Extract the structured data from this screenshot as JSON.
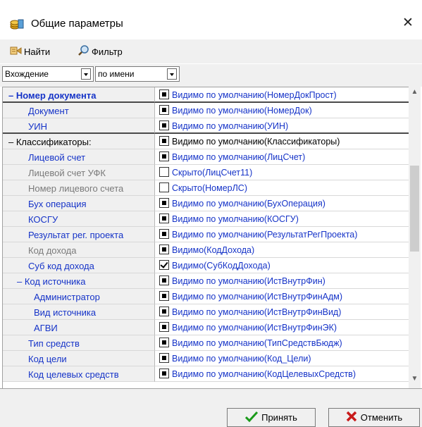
{
  "window": {
    "title": "Общие параметры",
    "close_label": "✕"
  },
  "toolbar": {
    "find_label": "Найти",
    "filter_label": "Фильтр"
  },
  "filterbar": {
    "mode_value": "Вхождение",
    "field_value": "по имени"
  },
  "rows": [
    {
      "label": "– Номер документа",
      "value": "Видимо по умолчанию(НомерДокПрост)",
      "check": "dot"
    },
    {
      "label": "Документ",
      "value": "Видимо по умолчанию(НомерДок)",
      "check": "dot"
    },
    {
      "label": "УИН",
      "value": "Видимо по умолчанию(УИН)",
      "check": "dot"
    },
    {
      "label": "– Классификаторы:",
      "value": "Видимо по умолчанию(Классификаторы)",
      "check": "dot"
    },
    {
      "label": "Лицевой счет",
      "value": "Видимо по умолчанию(ЛицСчет)",
      "check": "dot"
    },
    {
      "label": "Лицевой счет УФК",
      "value": "Скрыто(ЛицСчет11)",
      "check": "none"
    },
    {
      "label": "Номер лицевого счета",
      "value": "Скрыто(НомерЛС)",
      "check": "none"
    },
    {
      "label": "Бух операция",
      "value": "Видимо по умолчанию(БухОперация)",
      "check": "dot"
    },
    {
      "label": "КОСГУ",
      "value": "Видимо по умолчанию(КОСГУ)",
      "check": "dot"
    },
    {
      "label": "Результат рег. проекта",
      "value": "Видимо по умолчанию(РезультатРегПроекта)",
      "check": "dot"
    },
    {
      "label": "Код дохода",
      "value": "Видимо(КодДохода)",
      "check": "dot"
    },
    {
      "label": "Суб код дохода",
      "value": "Видимо(СубКодДохода)",
      "check": "check"
    },
    {
      "label": "– Код источника",
      "value": "Видимо по умолчанию(ИстВнутрФин)",
      "check": "dot"
    },
    {
      "label": "Администратор",
      "value": "Видимо по умолчанию(ИстВнутрФинАдм)",
      "check": "dot"
    },
    {
      "label": "Вид источника",
      "value": "Видимо по умолчанию(ИстВнутрФинВид)",
      "check": "dot"
    },
    {
      "label": "АГВИ",
      "value": "Видимо по умолчанию(ИстВнутрФинЭК)",
      "check": "dot"
    },
    {
      "label": "Тип средств",
      "value": "Видимо по умолчанию(ТипСредствБюдж)",
      "check": "dot"
    },
    {
      "label": "Код цели",
      "value": "Видимо по умолчанию(Код_Цели)",
      "check": "dot"
    },
    {
      "label": "Код целевых средств",
      "value": "Видимо по умолчанию(КодЦелевыхСредств)",
      "check": "dot"
    }
  ],
  "buttons": {
    "accept_label": "Принять",
    "cancel_label": "Отменить"
  }
}
